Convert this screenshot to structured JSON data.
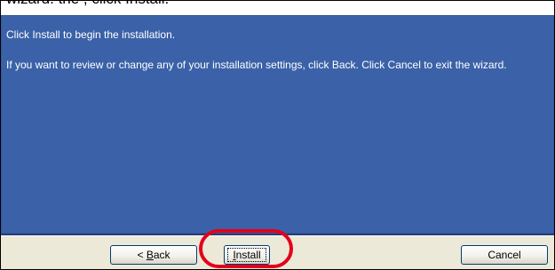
{
  "header": {
    "partial_text": "wizard.   the   , click Install."
  },
  "content": {
    "line1": "Click Install to begin the installation.",
    "line2": "If you want to review or change any of your installation settings, click Back. Click Cancel to exit the wizard."
  },
  "buttons": {
    "back": {
      "prefix": "< ",
      "accel": "B",
      "rest": "ack"
    },
    "install": {
      "accel": "I",
      "rest": "nstall"
    },
    "cancel": {
      "label": "Cancel"
    }
  },
  "colors": {
    "panel": "#3b62a8",
    "annotation": "#e3001b",
    "bar": "#ece9d8"
  }
}
